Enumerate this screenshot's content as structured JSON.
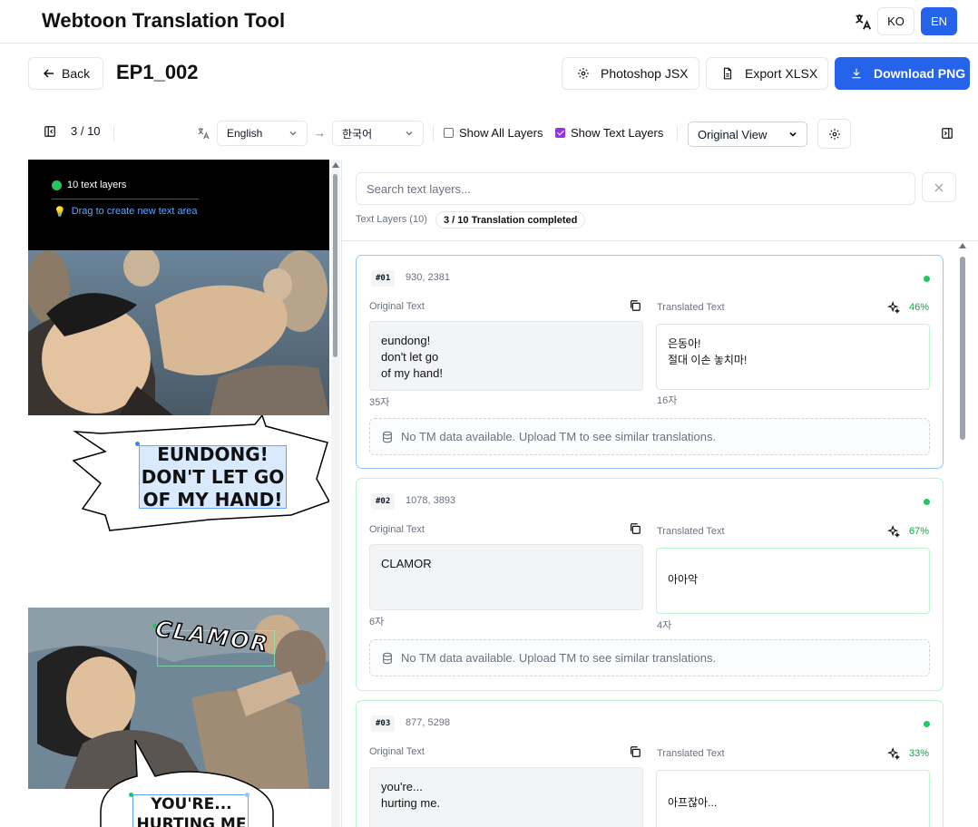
{
  "header": {
    "title": "Webtoon Translation Tool",
    "lang_ko": "KO",
    "lang_en": "EN",
    "translate_icon": "translate-icon"
  },
  "subheader": {
    "back_label": "Back",
    "episode": "EP1_002",
    "photoshop_label": "Photoshop JSX",
    "export_label": "Export XLSX",
    "download_label": "Download PNG"
  },
  "toolbar": {
    "page": "3 / 10",
    "source_lang": "English",
    "arrow": "→",
    "target_lang": "한국어",
    "show_all_layers": "Show All Layers",
    "show_all_layers_checked": false,
    "show_text_layers": "Show Text Layers",
    "show_text_layers_checked": true,
    "view_mode": "Original View"
  },
  "canvas": {
    "layers_info": "10 text layers",
    "hint": "Drag to create new text area",
    "bubble1": "EUNDONG!\nDON'T LET GO\nOF MY HAND!",
    "sfx": "CLAMOR",
    "bubble2": "YOU'RE...\nHURTING ME"
  },
  "panel": {
    "search_placeholder": "Search text layers...",
    "layers_count": "Text Layers (10)",
    "status": "3 / 10 Translation completed",
    "original_label": "Original Text",
    "translated_label": "Translated Text",
    "tm_message": "No TM data available. Upload TM to see similar translations."
  },
  "cards": [
    {
      "id": "#01",
      "coords": "930, 2381",
      "original": "eundong!\ndon't let go\nof my hand!",
      "translated": "은동아!\n절대 이손 놓치마!",
      "orig_count": "35자",
      "trans_count": "16자",
      "confidence": "46%"
    },
    {
      "id": "#02",
      "coords": "1078, 3893",
      "original": "CLAMOR",
      "translated": "아아악",
      "orig_count": "6자",
      "trans_count": "4자",
      "confidence": "67%"
    },
    {
      "id": "#03",
      "coords": "877, 5298",
      "original": "you're...\nhurting me.",
      "translated": "아프잖아...",
      "orig_count": "",
      "trans_count": "",
      "confidence": "33%"
    }
  ],
  "colors": {
    "accent": "#2563eb",
    "success": "#22c55e",
    "checkbox": "#9333ea"
  }
}
